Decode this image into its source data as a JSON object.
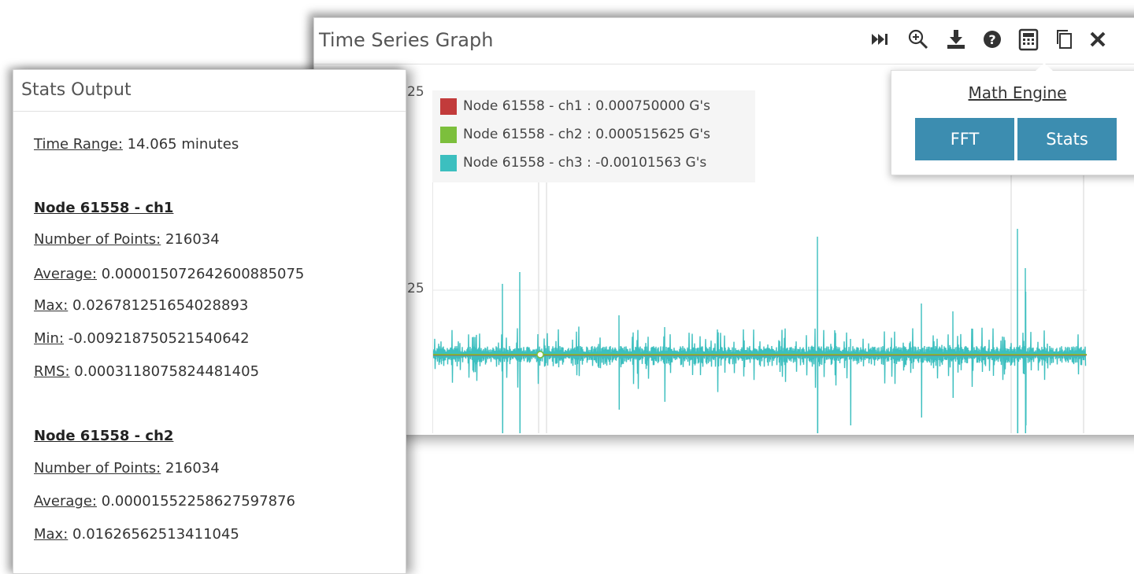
{
  "graph": {
    "title": "Time Series Graph",
    "toolbar_icons": [
      "skip-end-icon",
      "zoom-in-icon",
      "download-icon",
      "help-icon",
      "calculator-icon",
      "copy-icon",
      "close-icon"
    ],
    "y_ticks": [
      "25",
      "25"
    ],
    "legend": [
      {
        "label": "Node 61558 - ch1 : 0.000750000 G's",
        "color": "#c23b3b"
      },
      {
        "label": "Node 61558 - ch2 : 0.000515625 G's",
        "color": "#7cbf3c"
      },
      {
        "label": "Node 61558 - ch3 : -0.00101563 G's",
        "color": "#3cbfbf"
      }
    ],
    "math_engine": {
      "title": "Math Engine",
      "buttons": [
        "FFT",
        "Stats"
      ]
    }
  },
  "stats": {
    "title": "Stats Output",
    "time_range_label": "Time Range:",
    "time_range_value": "14.065 minutes",
    "nodes": [
      {
        "name": "Node 61558 - ch1",
        "rows": [
          {
            "label": "Number of Points:",
            "value": "216034"
          },
          {
            "label": "Average:",
            "value": "0.000015072642600885075"
          },
          {
            "label": "Max:",
            "value": "0.026781251654028893"
          },
          {
            "label": "Min:",
            "value": "-0.009218750521540642"
          },
          {
            "label": "RMS:",
            "value": "0.0003118075824481405"
          }
        ]
      },
      {
        "name": "Node 61558 - ch2",
        "rows": [
          {
            "label": "Number of Points:",
            "value": "216034"
          },
          {
            "label": "Average:",
            "value": "0.00001552258627597876"
          },
          {
            "label": "Max:",
            "value": "0.01626562513411045"
          }
        ]
      }
    ]
  }
}
